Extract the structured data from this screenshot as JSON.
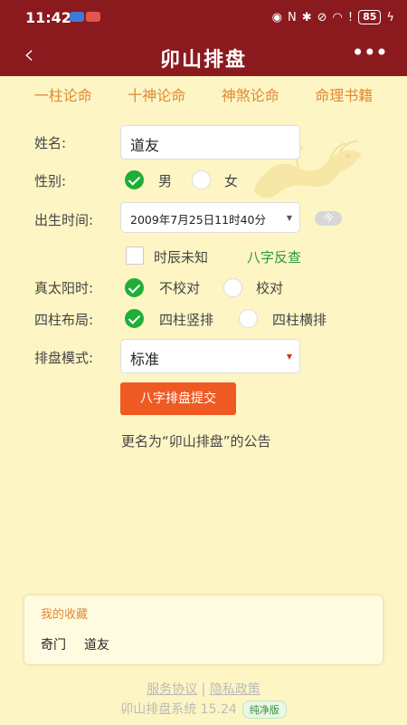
{
  "statusbar": {
    "time": "11:42",
    "battery": "85"
  },
  "navbar": {
    "back_glyph": "‹",
    "title": "卯山排盘",
    "more_glyph": "•••"
  },
  "tabs": [
    "一柱论命",
    "十神论命",
    "神煞论命",
    "命理书籍"
  ],
  "form": {
    "name_label": "姓名:",
    "name_value": "道友",
    "gender_label": "性别:",
    "gender_options": [
      "男",
      "女"
    ],
    "birth_label": "出生时间:",
    "birth_value": "2009年7月25日11时40分",
    "today_label": "今",
    "unknown_hour": "时辰未知",
    "reverse_lookup": "八字反查",
    "solar_label": "真太阳时:",
    "solar_options": [
      "不校对",
      "校对"
    ],
    "layout_label": "四柱布局:",
    "layout_options": [
      "四柱竖排",
      "四柱横排"
    ],
    "mode_label": "排盘模式:",
    "mode_value": "标准",
    "submit_label": "八字排盘提交"
  },
  "notice": "更名为“卯山排盘”的公告",
  "favorites": {
    "title": "我的收藏",
    "items": [
      "奇门",
      "道友"
    ]
  },
  "footer": {
    "service": "服务协议",
    "separator": "|",
    "privacy": "隐私政策",
    "version": "卯山排盘系统 15.24",
    "badge": "纯净版"
  },
  "colors": {
    "header": "#8b1a1e",
    "background": "#fdf5c4",
    "accent_orange": "#e08a36",
    "check_green": "#1fae37",
    "submit": "#ef5a22"
  }
}
